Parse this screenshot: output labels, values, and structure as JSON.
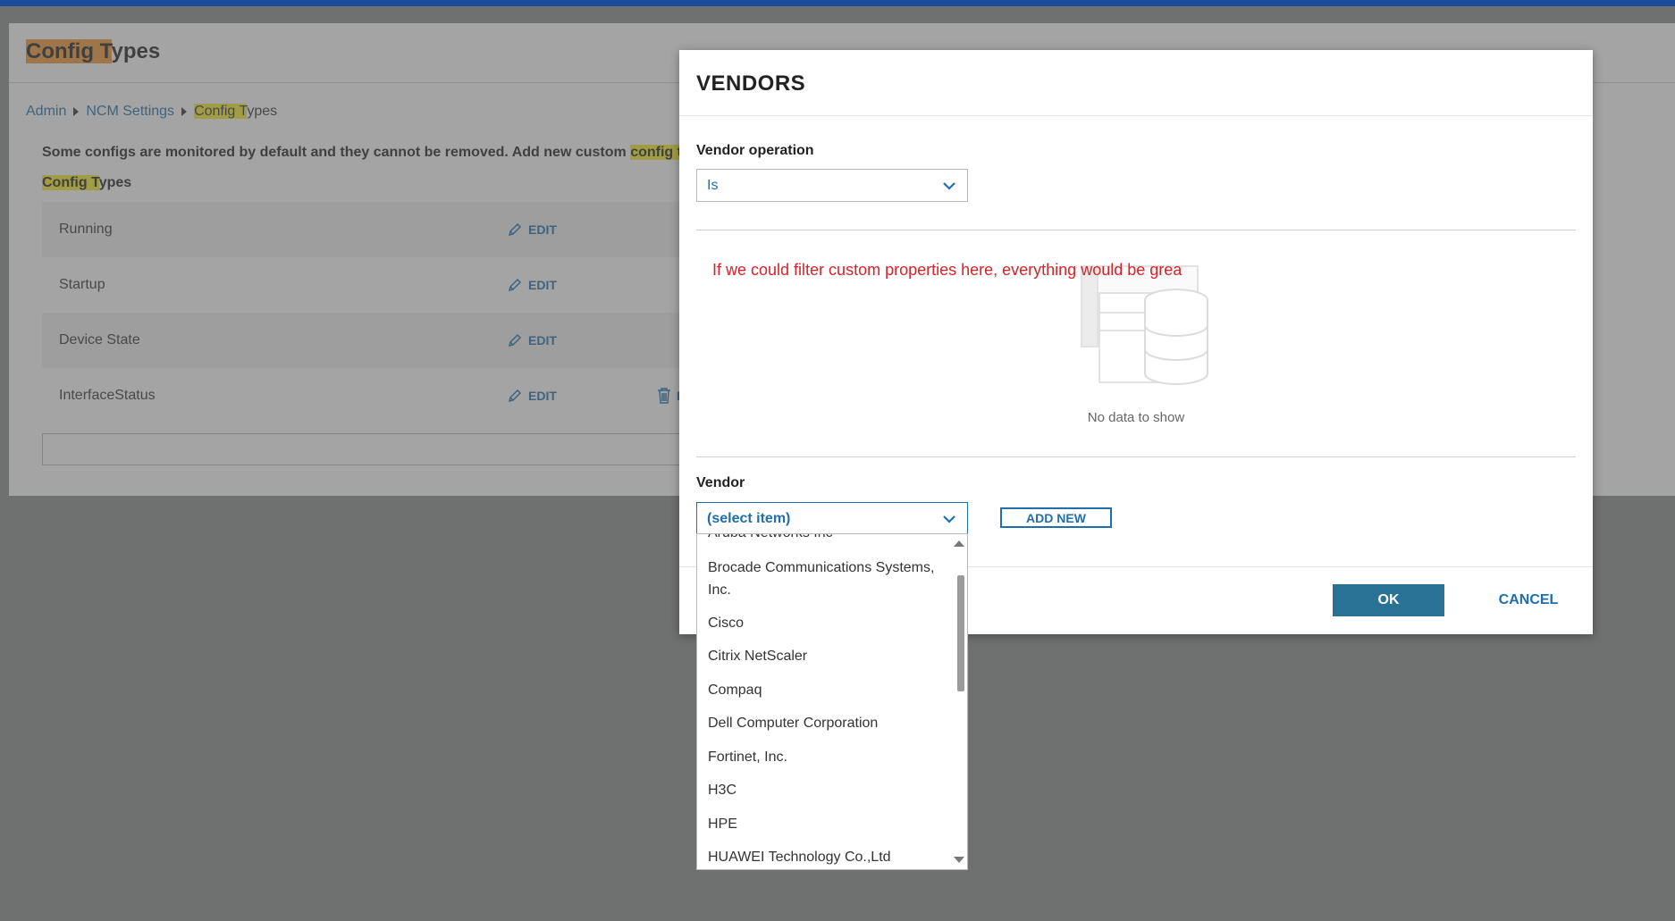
{
  "page": {
    "title_hl": "Config T",
    "title_rest": "ypes",
    "breadcrumb": [
      "Admin",
      "NCM Settings"
    ],
    "breadcrumb_current_hl": "Config T",
    "breadcrumb_current_rest": "ypes",
    "description_pre": "Some configs are monitored by default and they cannot be removed. Add new custom ",
    "description_hl": "config ty",
    "subhead_hl": "Config T",
    "subhead_rest": "ypes",
    "rows": [
      {
        "name": "Running",
        "edit": "EDIT",
        "remove": ""
      },
      {
        "name": "Startup",
        "edit": "EDIT",
        "remove": ""
      },
      {
        "name": "Device State",
        "edit": "EDIT",
        "remove": ""
      },
      {
        "name": "InterfaceStatus",
        "edit": "EDIT",
        "remove": "R"
      }
    ]
  },
  "modal": {
    "title": "VENDORS",
    "vendor_operation_label": "Vendor operation",
    "vendor_operation_value": "Is",
    "note": "If we could filter custom properties here, everything would be grea",
    "no_data": "No data to show",
    "vendor_label": "Vendor",
    "vendor_select_value": "(select item)",
    "add_new": "ADD NEW",
    "ok": "OK",
    "cancel": "CANCEL"
  },
  "dropdown": {
    "items": [
      "Aruba Networks Inc",
      "Brocade Communications Systems, Inc.",
      "Cisco",
      "Citrix NetScaler",
      "Compaq",
      "Dell Computer Corporation",
      "Fortinet, Inc.",
      "H3C",
      "HPE",
      "HUAWEI Technology Co.,Ltd"
    ]
  },
  "colors": {
    "accent": "#1f6fae",
    "primary_button": "#2a7196",
    "note_red": "#d6232a",
    "highlight_orange": "#f39a35",
    "highlight_yellow": "#f7f02a"
  }
}
